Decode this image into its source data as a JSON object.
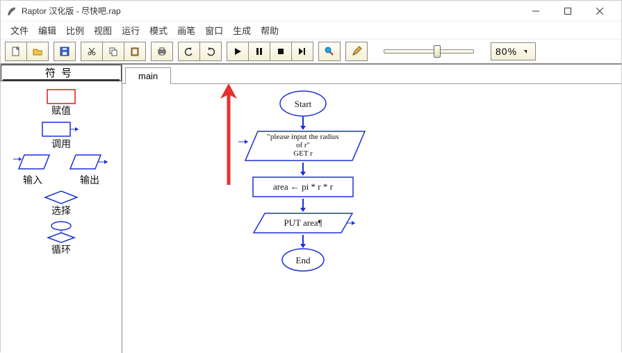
{
  "window": {
    "title": "Raptor 汉化版 - 尽快吧.rap"
  },
  "menu": {
    "file": "文件",
    "edit": "编辑",
    "scale": "比例",
    "view": "视图",
    "run": "运行",
    "mode": "模式",
    "brush": "画笔",
    "window": "窗口",
    "generate": "生成",
    "help": "帮助"
  },
  "toolbar": {
    "zoom_value": "80%"
  },
  "sidebar": {
    "header": "符号",
    "assign": "赋值",
    "call": "调用",
    "input": "输入",
    "output": "输出",
    "select": "选择",
    "loop": "循环"
  },
  "tabs": {
    "main": "main"
  },
  "flowchart": {
    "start": "Start",
    "input_line1": "\"please input the radius",
    "input_line2": "of r\"",
    "input_line3": "GET r",
    "assign": "area ← pi * r * r",
    "output": "PUT area¶",
    "end": "End"
  }
}
